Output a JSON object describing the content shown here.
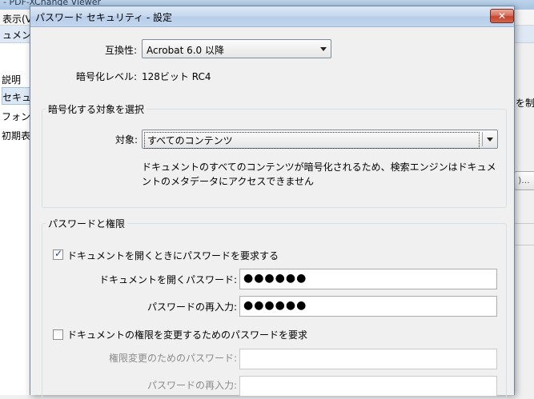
{
  "background": {
    "app_title": "- PDF-XChange Viewer",
    "menu_item": "表示(V",
    "doc_tab": "ュメント",
    "left_items": [
      "説明",
      "セキュ",
      "フォン",
      "初期表"
    ],
    "right_text": "を制",
    "right_button": ")..."
  },
  "dialog": {
    "title": "パスワード セキュリティ - 設定",
    "close_symbol": "✕",
    "compat_label": "互換性:",
    "compat_value": "Acrobat 6.0 以降",
    "enc_level_label": "暗号化レベル:",
    "enc_level_value": "128ビット RC4",
    "encrypt_group": {
      "title": "暗号化する対象を選択",
      "target_label": "対象:",
      "target_value": "すべてのコンテンツ",
      "description_line1": "ドキュメントのすべてのコンテンツが暗号化されるため、検索エンジンはドキュメ",
      "description_line2": "ントのメタデータにアクセスできません"
    },
    "password_group": {
      "title": "パスワードと権限",
      "require_open_label": "ドキュメントを開くときにパスワードを要求する",
      "require_open_checked": true,
      "open_password_label": "ドキュメントを開くパスワード:",
      "open_password_value": "●●●●●●",
      "open_password_confirm_label": "パスワードの再入力:",
      "open_password_confirm_value": "●●●●●●",
      "require_perm_label": "ドキュメントの権限を変更するためのパスワードを要求",
      "require_perm_checked": false,
      "perm_password_label": "権限変更のためのパスワード:",
      "perm_password_value": "",
      "perm_password_confirm_label": "パスワードの再入力:",
      "perm_password_confirm_value": ""
    }
  },
  "colors": {
    "titlebar": "#c6d8ee",
    "close_button": "#c4442c",
    "checkmark": "#2c4a87",
    "disabled_text": "#8a8a8a"
  }
}
